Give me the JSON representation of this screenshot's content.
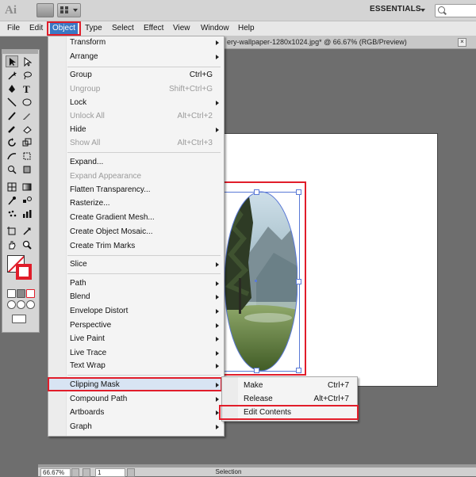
{
  "app": {
    "logo": "Ai",
    "workspace": "ESSENTIALS"
  },
  "menubar": {
    "items": [
      "File",
      "Edit",
      "Object",
      "Type",
      "Select",
      "Effect",
      "View",
      "Window",
      "Help"
    ],
    "active": "Object"
  },
  "document": {
    "tab_title": "ery-wallpaper-1280x1024.jpg* @ 66.67% (RGB/Preview)",
    "close_label": "×"
  },
  "object_menu": {
    "items": [
      {
        "label": "Transform",
        "shortcut": "",
        "submenu": true,
        "enabled": true
      },
      {
        "label": "Arrange",
        "shortcut": "",
        "submenu": true,
        "enabled": true
      },
      {
        "label": "Group",
        "shortcut": "Ctrl+G",
        "submenu": false,
        "enabled": true
      },
      {
        "label": "Ungroup",
        "shortcut": "Shift+Ctrl+G",
        "submenu": false,
        "enabled": false
      },
      {
        "label": "Lock",
        "shortcut": "",
        "submenu": true,
        "enabled": true
      },
      {
        "label": "Unlock All",
        "shortcut": "Alt+Ctrl+2",
        "submenu": false,
        "enabled": false
      },
      {
        "label": "Hide",
        "shortcut": "",
        "submenu": true,
        "enabled": true
      },
      {
        "label": "Show All",
        "shortcut": "Alt+Ctrl+3",
        "submenu": false,
        "enabled": false
      },
      {
        "label": "Expand...",
        "shortcut": "",
        "submenu": false,
        "enabled": true
      },
      {
        "label": "Expand Appearance",
        "shortcut": "",
        "submenu": false,
        "enabled": false
      },
      {
        "label": "Flatten Transparency...",
        "shortcut": "",
        "submenu": false,
        "enabled": true
      },
      {
        "label": "Rasterize...",
        "shortcut": "",
        "submenu": false,
        "enabled": true
      },
      {
        "label": "Create Gradient Mesh...",
        "shortcut": "",
        "submenu": false,
        "enabled": true
      },
      {
        "label": "Create Object Mosaic...",
        "shortcut": "",
        "submenu": false,
        "enabled": true
      },
      {
        "label": "Create Trim Marks",
        "shortcut": "",
        "submenu": false,
        "enabled": true
      },
      {
        "label": "Slice",
        "shortcut": "",
        "submenu": true,
        "enabled": true
      },
      {
        "label": "Path",
        "shortcut": "",
        "submenu": true,
        "enabled": true
      },
      {
        "label": "Blend",
        "shortcut": "",
        "submenu": true,
        "enabled": true
      },
      {
        "label": "Envelope Distort",
        "shortcut": "",
        "submenu": true,
        "enabled": true
      },
      {
        "label": "Perspective",
        "shortcut": "",
        "submenu": true,
        "enabled": true
      },
      {
        "label": "Live Paint",
        "shortcut": "",
        "submenu": true,
        "enabled": true
      },
      {
        "label": "Live Trace",
        "shortcut": "",
        "submenu": true,
        "enabled": true
      },
      {
        "label": "Text Wrap",
        "shortcut": "",
        "submenu": true,
        "enabled": true
      },
      {
        "label": "Clipping Mask",
        "shortcut": "",
        "submenu": true,
        "enabled": true,
        "highlighted": true
      },
      {
        "label": "Compound Path",
        "shortcut": "",
        "submenu": true,
        "enabled": true
      },
      {
        "label": "Artboards",
        "shortcut": "",
        "submenu": true,
        "enabled": true
      },
      {
        "label": "Graph",
        "shortcut": "",
        "submenu": true,
        "enabled": true
      }
    ]
  },
  "clipping_submenu": {
    "items": [
      {
        "label": "Make",
        "shortcut": "Ctrl+7"
      },
      {
        "label": "Release",
        "shortcut": "Alt+Ctrl+7"
      },
      {
        "label": "Edit Contents",
        "shortcut": ""
      }
    ]
  },
  "statusbar": {
    "zoom": "66.67%",
    "artboard": "1",
    "status": "Selection"
  },
  "colors": {
    "highlight_box": "#e11d2a",
    "menu_active": "#3a78c4",
    "selection": "#5a79d6"
  }
}
